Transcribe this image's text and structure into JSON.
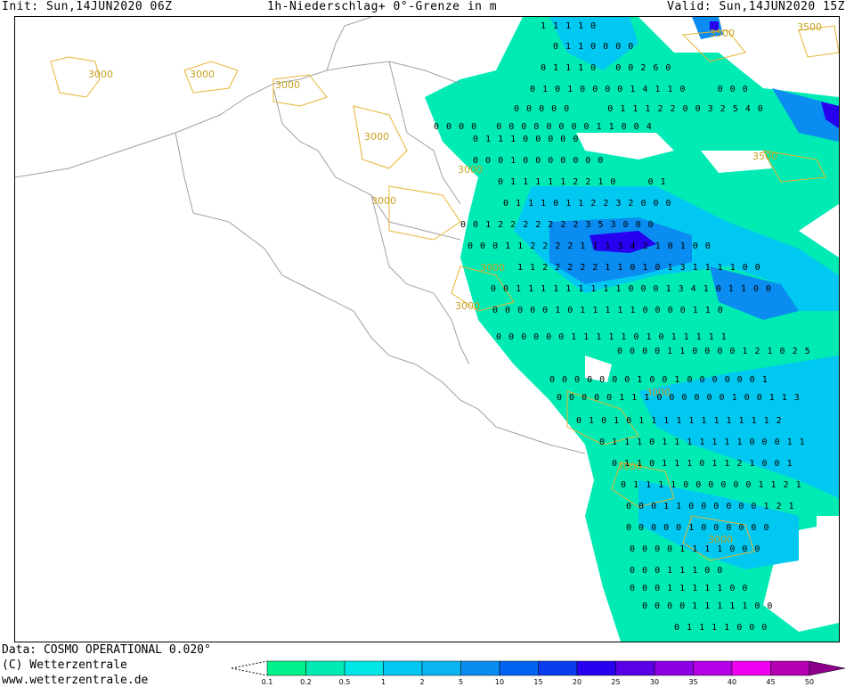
{
  "header": {
    "init": "Init: Sun,14JUN2020 06Z",
    "title": "1h-Niederschlag+ 0°-Grenze in m",
    "valid": "Valid: Sun,14JUN2020 15Z"
  },
  "footer": {
    "data_source": "Data: COSMO OPERATIONAL 0.020°",
    "copyright": "(C) Wetterzentrale",
    "url": "www.wetterzentrale.de"
  },
  "contour_labels": [
    "3000",
    "3000",
    "3000",
    "3000",
    "3000",
    "3000",
    "3000",
    "3000",
    "3500",
    "3500",
    "3500",
    "3000",
    "3000",
    "3000"
  ],
  "legend": {
    "values": [
      "0.1",
      "0.2",
      "0.5",
      "1",
      "2",
      "5",
      "10",
      "15",
      "20",
      "25",
      "30",
      "35",
      "40",
      "45",
      "50"
    ],
    "colors": [
      "#00f08c",
      "#00ebb4",
      "#00e6e6",
      "#00c8f0",
      "#0ab4f0",
      "#0a8cf0",
      "#0064f0",
      "#0a3cf0",
      "#2800f0",
      "#5a00e6",
      "#8c00e6",
      "#b400e6",
      "#f000f0",
      "#b400b4",
      "#8c008c"
    ]
  },
  "precip_values": [
    "1 1 1 1 0",
    "0 1 1 0 0 0 0",
    "0 1 1 1 0   0 0 2 6 0",
    "0 1 0 1 0 0 0 0 1 4 1 1 0     0 0 0",
    "0 0 0 0 0      0 1 1 1 2 2 0 0 3 2 5 4 0",
    "0 0 0 0   0 0 0 0 0 0 0 0 1 1 0 0 4",
    "0 1 1 1 0 0 0 0 0",
    "0 0 0 1 0 0 0 0 0 0 0",
    "0 1 1 1 1 1 2 2 1 0     0 1",
    "0 1 1 1 0 1 1 2 2 3 2 0 0 0",
    "0 0 1 2 2 2 2 2 2 2 3 5 3 0 0 0",
    "0 0 0 1 1 2 2 2 2 1 1 1 3 4 2 1 0 1 0 0",
    "1 1 2 2 2 2 2 1 1 0 1 0 1 3 1 1 1 1 0 0",
    "0 0 1 1 1 1 1 1 1 1 1 0 0 0 1 3 4 1 0 1 1 0 0",
    "0 0 0 0 0 1 0 1 1 1 1 1 0 0 0 0 1 1 0",
    "0 0 0 0 0 0 1 1 1 1 1 0 1 0 1 1 1 1 1",
    "0 0 0 0 1 1 0 0 0 0 1 2 1 0 2 5",
    "0 0 0 0 0 0 0 1 0 0 1 0 0 0 0 0 0 1",
    "0 0 0 0 0 1 1 1 0 0 0 0 0 0 1 0 0 1 1 3",
    "0 1 0 1 0 1 1 1 1 1 1 1 1 1 1 1 2",
    "0 1 1 1 0 1 1 1 1 1 1 1 0 0 0 1 1",
    "0 1 1 0 1 1 1 0 1 1 2 1 0 0 1",
    "0 1 1 1 1 0 0 0 0 0 0 1 1 2 1",
    "0 0 0 1 1 0 0 0 0 0 0 1 2 1",
    "0 0 0 0 0 1 0 0 0 0 0 0",
    "0 0 0 0 1 1 1 1 0 0 0",
    "0 0 0 1 1 1 0 0",
    "0 0 0 1 1 1 1 1 0 0",
    "0 0 0 0 1 1 1 1 1 0 0",
    "0 1 1 1 1 0 0 0"
  ]
}
